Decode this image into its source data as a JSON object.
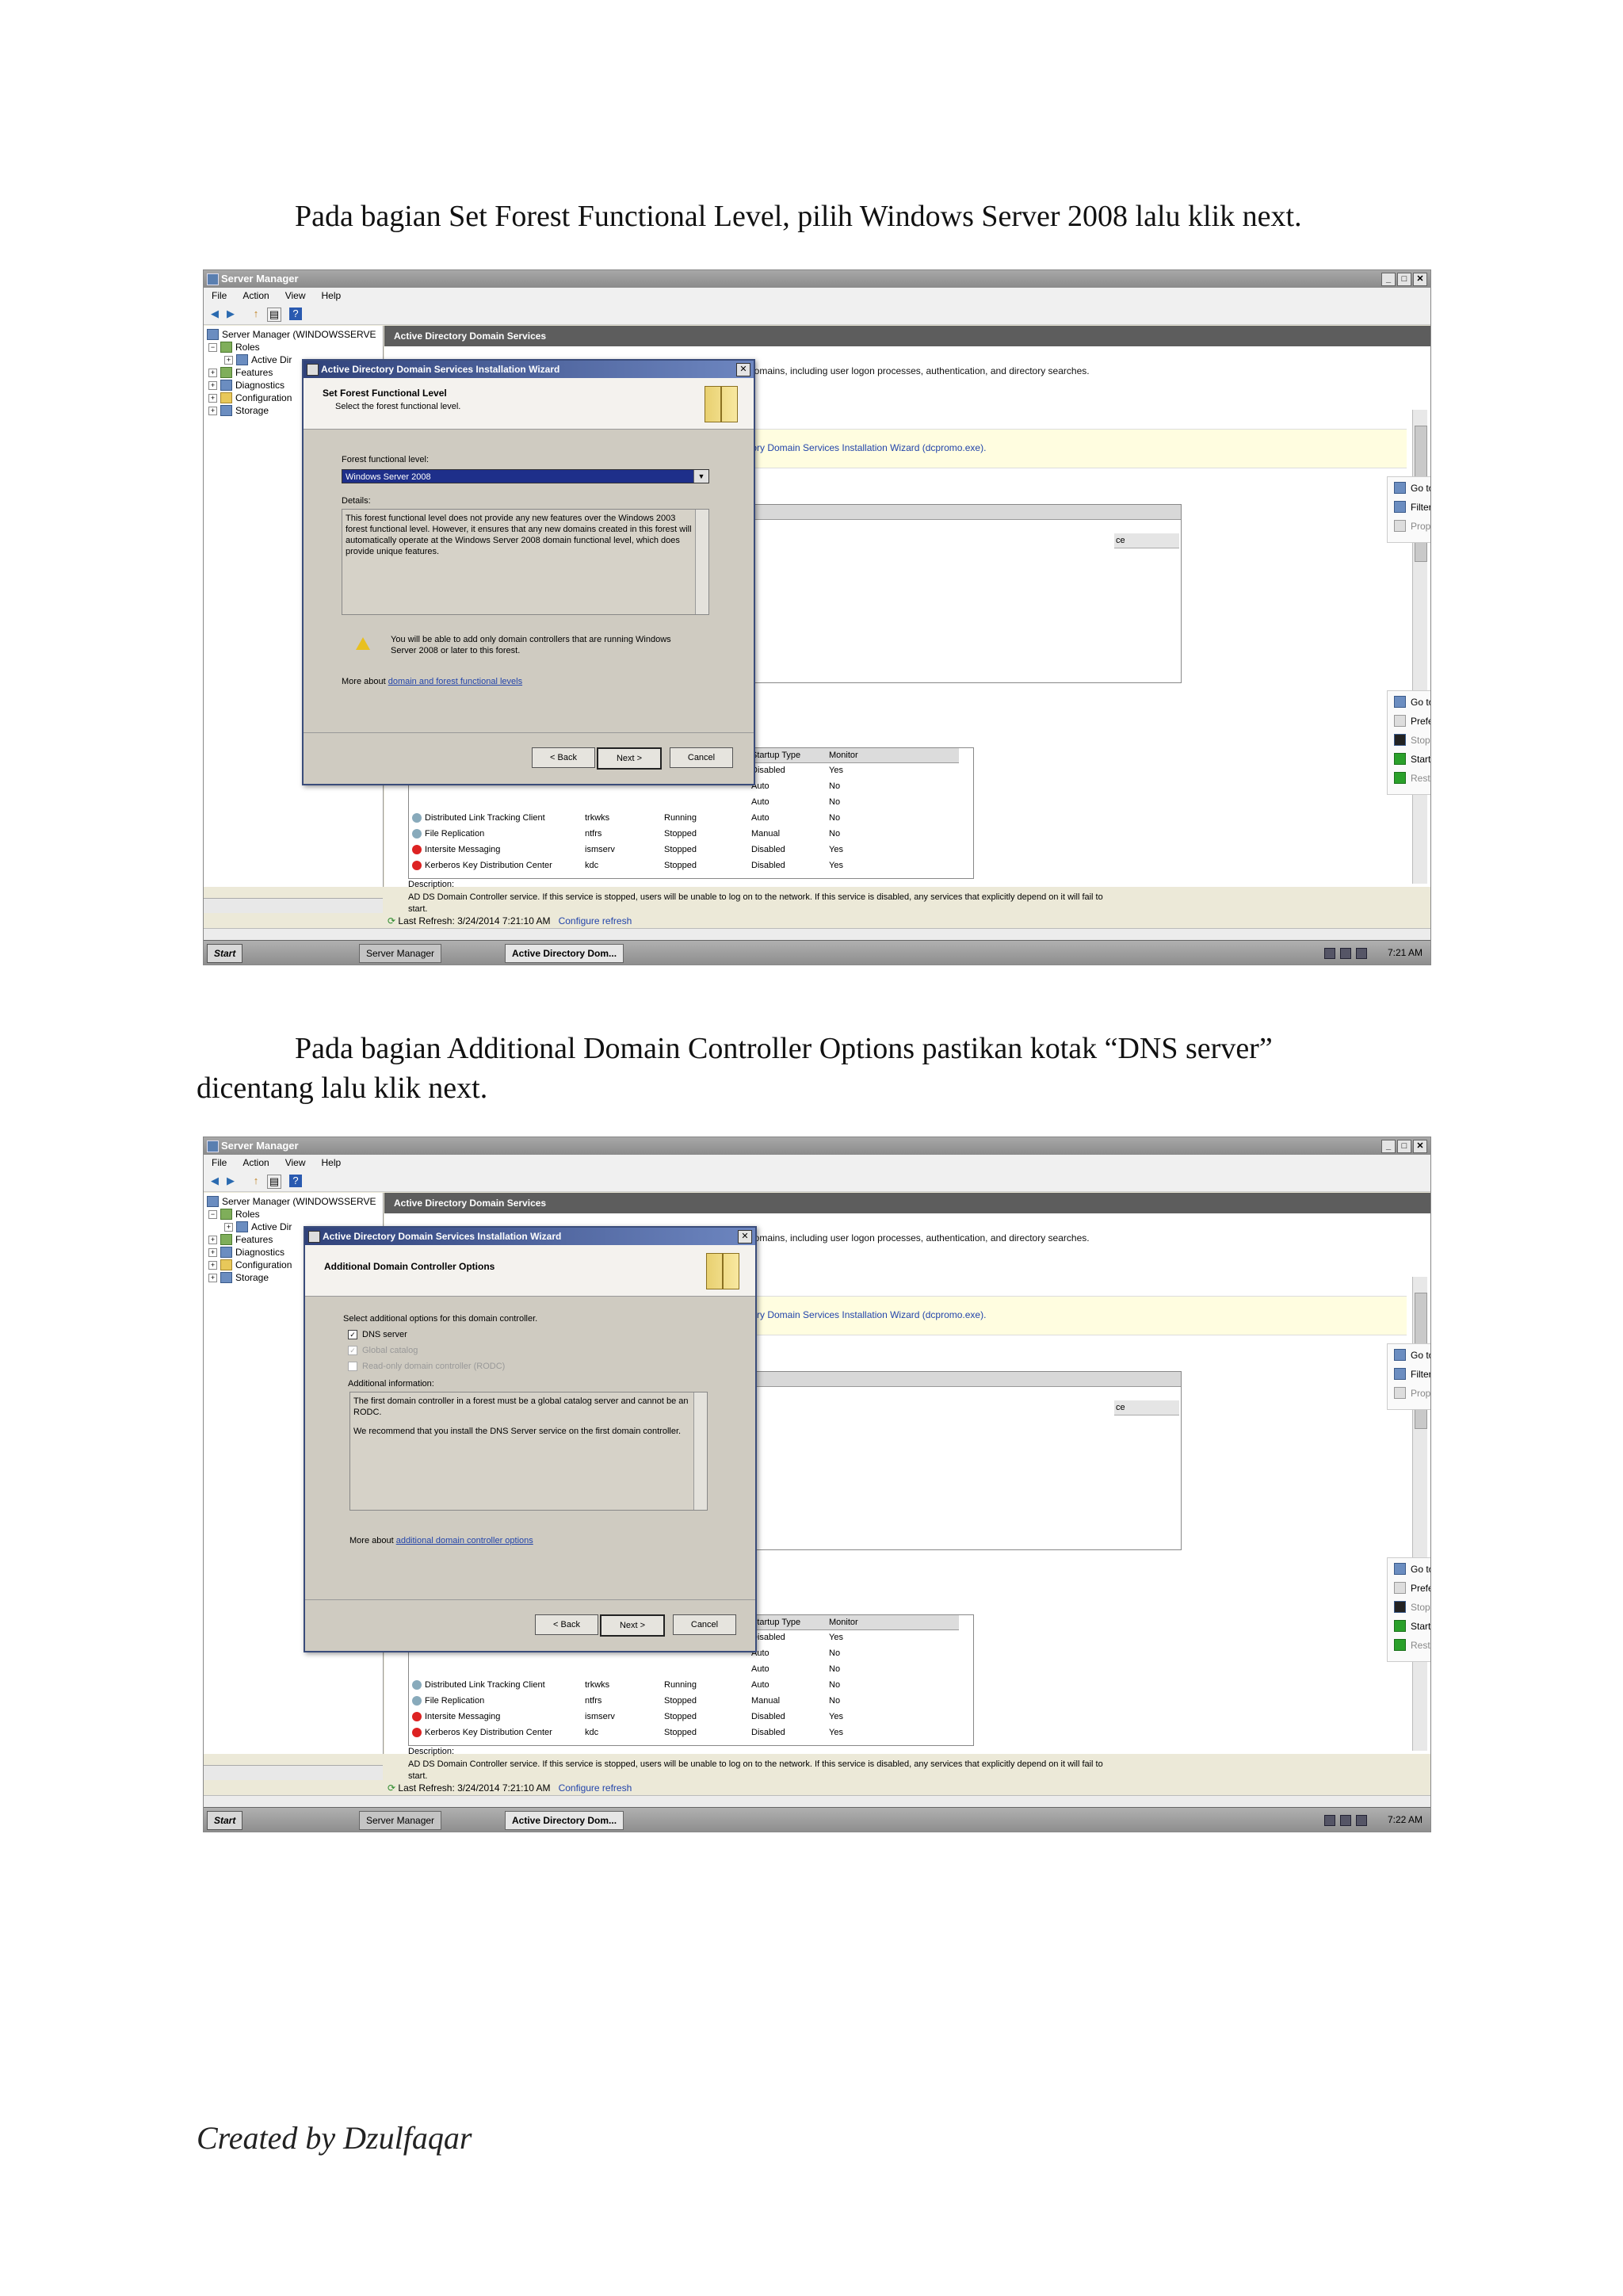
{
  "paragraph1": "Pada bagian Set Forest Functional Level, pilih Windows Server 2008 lalu klik next.",
  "paragraph2_line1": "Pada bagian Additional Domain Controller Options pastikan kotak “DNS server”",
  "paragraph2_line2": "dicentang lalu klik next.",
  "footer": "Created by Dzulfaqar",
  "server_manager": {
    "title": "Server Manager",
    "menu": [
      "File",
      "Action",
      "View",
      "Help"
    ],
    "tree": {
      "root": "Server Manager (WINDOWSSERVE",
      "roles": "Roles",
      "active_dir": "Active Dir",
      "features": "Features",
      "diagnostics": "Diagnostics",
      "configuration": "Configuration",
      "storage": "Storage"
    },
    "pane_header": "Active Directory Domain Services",
    "pane_desc": "domains, including user logon processes, authentication, and directory searches.",
    "band_link": "tory Domain Services Installation Wizard (dcpromo.exe).",
    "grid_col": "ce",
    "actions_top": [
      "Go to Event Viewer",
      "Filter Events",
      "Properties"
    ],
    "actions_bottom": [
      "Go to Services",
      "Preferences",
      "Stop",
      "Start",
      "Restart"
    ],
    "services_header": [
      "Startup Type",
      "Monitor"
    ],
    "services_top_rows": [
      [
        "Disabled",
        "Yes"
      ],
      [
        "Auto",
        "No"
      ],
      [
        "Auto",
        "No"
      ]
    ],
    "services": [
      [
        "Distributed Link Tracking Client",
        "trkwks",
        "Running",
        "Auto",
        "No"
      ],
      [
        "File Replication",
        "ntfrs",
        "Stopped",
        "Manual",
        "No"
      ],
      [
        "Intersite Messaging",
        "ismserv",
        "Stopped",
        "Disabled",
        "Yes"
      ],
      [
        "Kerberos Key Distribution Center",
        "kdc",
        "Stopped",
        "Disabled",
        "Yes"
      ]
    ],
    "description_label": "Description:",
    "description_text": "AD DS Domain Controller service. If this service is stopped, users will be unable to log on to the network. If this service is disabled, any services that explicitly depend on it will fail to",
    "description_text2": "start.",
    "last_refresh": "Last Refresh: 3/24/2014 7:21:10 AM",
    "configure_refresh": "Configure refresh",
    "taskbar": {
      "start": "Start",
      "task1": "Server Manager",
      "task2": "Active Directory Dom..."
    }
  },
  "wizard1": {
    "title": "Active Directory Domain Services Installation Wizard",
    "heading": "Set Forest Functional Level",
    "subheading": "Select the forest functional level.",
    "level_label": "Forest functional level:",
    "level_value": "Windows Server 2008",
    "details_label": "Details:",
    "details_text": "This forest functional level does not provide any new features over the Windows 2003 forest functional level. However, it ensures that any new domains created in this forest will automatically operate at the Windows Server 2008 domain functional level, which does provide unique features.",
    "warning": "You will be able to add only domain controllers that are running Windows Server 2008 or later to this forest.",
    "more_prefix": "More about ",
    "more_link": "domain and forest functional levels",
    "back": "< Back",
    "next": "Next >",
    "cancel": "Cancel",
    "clock": "7:21 AM"
  },
  "wizard2": {
    "title": "Active Directory Domain Services Installation Wizard",
    "heading": "Additional Domain Controller Options",
    "select_label": "Select additional options for this domain controller.",
    "opt_dns": "DNS server",
    "opt_gc": "Global catalog",
    "opt_rodc": "Read-only domain controller (RODC)",
    "info_label": "Additional information:",
    "info_text1": "The first domain controller in a forest must be a global catalog server and cannot be an RODC.",
    "info_text2": "We recommend that you install the DNS Server service on the first domain controller.",
    "more_prefix": "More about ",
    "more_link": "additional domain controller options",
    "back": "< Back",
    "next": "Next >",
    "cancel": "Cancel",
    "clock": "7:22 AM"
  }
}
